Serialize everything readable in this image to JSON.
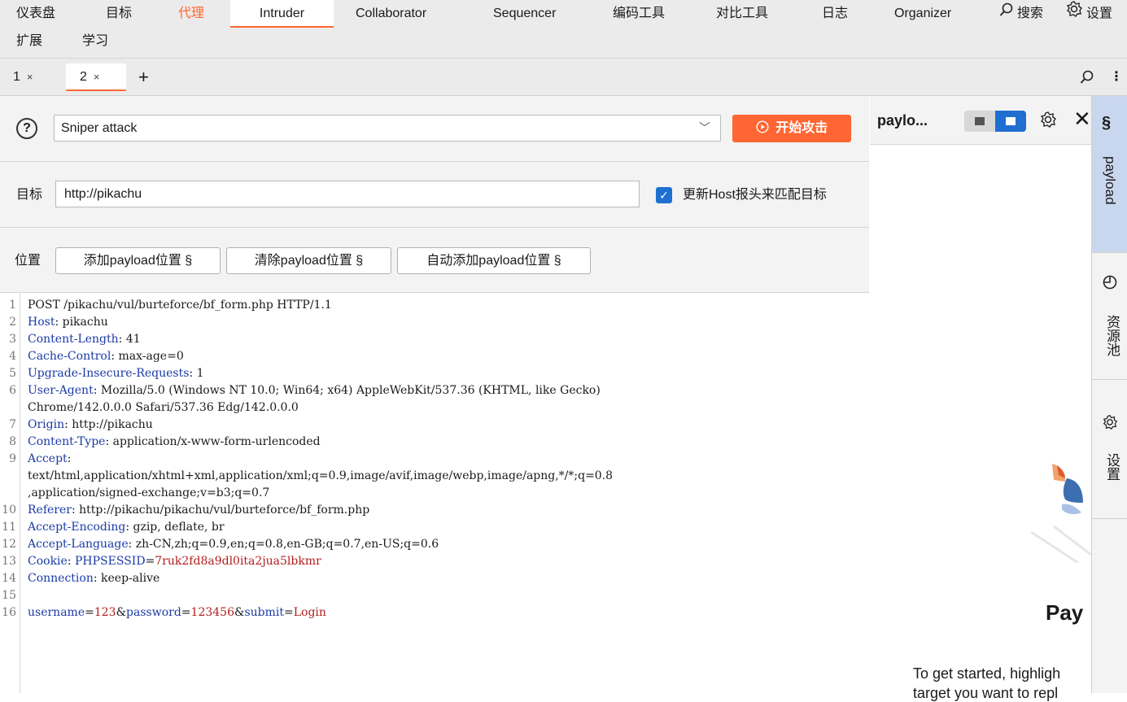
{
  "menu": {
    "row1": [
      "仪表盘",
      "目标",
      "代理",
      "Intruder",
      "Collaborator",
      "Sequencer",
      "编码工具",
      "对比工具",
      "日志",
      "Organizer"
    ],
    "search_label": "搜索",
    "settings_label": "设置",
    "row2": [
      "扩展",
      "学习"
    ],
    "active_item": "代理",
    "selected_item": "Intruder"
  },
  "tabs": {
    "items": [
      {
        "label": "1",
        "close": "×"
      },
      {
        "label": "2",
        "close": "×"
      }
    ],
    "add": "+",
    "more": "⋮"
  },
  "attack": {
    "help": "?",
    "type": "Sniper attack",
    "start_label": "开始攻击"
  },
  "target": {
    "label": "目标",
    "value": "http://pikachu",
    "update_host_label": "更新Host报头来匹配目标",
    "update_host_checked": true
  },
  "positions": {
    "label": "位置",
    "add_label": "添加payload位置 §",
    "clear_label": "清除payload位置 §",
    "auto_label": "自动添加payload位置 §"
  },
  "request_lines": [
    {
      "n": "1",
      "parts": [
        {
          "t": "POST /pikachu/vul/burteforce/bf_form.php HTTP/1.1",
          "c": ""
        }
      ]
    },
    {
      "n": "2",
      "parts": [
        {
          "t": "Host",
          "c": "key"
        },
        {
          "t": ": pikachu",
          "c": ""
        }
      ]
    },
    {
      "n": "3",
      "parts": [
        {
          "t": "Content-Length",
          "c": "key"
        },
        {
          "t": ": 41",
          "c": ""
        }
      ]
    },
    {
      "n": "4",
      "parts": [
        {
          "t": "Cache-Control",
          "c": "key"
        },
        {
          "t": ": max-age=0",
          "c": ""
        }
      ]
    },
    {
      "n": "5",
      "parts": [
        {
          "t": "Upgrade-Insecure-Requests",
          "c": "key"
        },
        {
          "t": ": 1",
          "c": ""
        }
      ]
    },
    {
      "n": "6",
      "parts": [
        {
          "t": "User-Agent",
          "c": "key"
        },
        {
          "t": ": Mozilla/5.0 (Windows NT 10.0; Win64; x64) AppleWebKit/537.36 (KHTML, like Gecko)",
          "c": ""
        }
      ]
    },
    {
      "n": "",
      "parts": [
        {
          "t": "Chrome/142.0.0.0 Safari/537.36 Edg/142.0.0.0",
          "c": ""
        }
      ]
    },
    {
      "n": "7",
      "parts": [
        {
          "t": "Origin",
          "c": "key"
        },
        {
          "t": ": http://pikachu",
          "c": ""
        }
      ]
    },
    {
      "n": "8",
      "parts": [
        {
          "t": "Content-Type",
          "c": "key"
        },
        {
          "t": ": application/x-www-form-urlencoded",
          "c": ""
        }
      ]
    },
    {
      "n": "9",
      "parts": [
        {
          "t": "Accept",
          "c": "key"
        },
        {
          "t": ":",
          "c": ""
        }
      ]
    },
    {
      "n": "",
      "parts": [
        {
          "t": "text/html,application/xhtml+xml,application/xml;q=0.9,image/avif,image/webp,image/apng,*/*;q=0.8",
          "c": ""
        }
      ]
    },
    {
      "n": "",
      "parts": [
        {
          "t": ",application/signed-exchange;v=b3;q=0.7",
          "c": ""
        }
      ]
    },
    {
      "n": "10",
      "parts": [
        {
          "t": "Referer",
          "c": "key"
        },
        {
          "t": ": http://pikachu/pikachu/vul/burteforce/bf_form.php",
          "c": ""
        }
      ]
    },
    {
      "n": "11",
      "parts": [
        {
          "t": "Accept-Encoding",
          "c": "key"
        },
        {
          "t": ": gzip, deflate, br",
          "c": ""
        }
      ]
    },
    {
      "n": "12",
      "parts": [
        {
          "t": "Accept-Language",
          "c": "key"
        },
        {
          "t": ": zh-CN,zh;q=0.9,en;q=0.8,en-GB;q=0.7,en-US;q=0.6",
          "c": ""
        }
      ]
    },
    {
      "n": "13",
      "parts": [
        {
          "t": "Cookie",
          "c": "key"
        },
        {
          "t": ": ",
          "c": ""
        },
        {
          "t": "PHPSESSID",
          "c": "key"
        },
        {
          "t": "=",
          "c": ""
        },
        {
          "t": "7ruk2fd8a9dl0ita2jua5lbkmr",
          "c": "val"
        }
      ]
    },
    {
      "n": "14",
      "parts": [
        {
          "t": "Connection",
          "c": "key"
        },
        {
          "t": ": keep-alive",
          "c": ""
        }
      ]
    },
    {
      "n": "15",
      "parts": []
    },
    {
      "n": "16",
      "parts": [
        {
          "t": "username",
          "c": "key"
        },
        {
          "t": "=",
          "c": ""
        },
        {
          "t": "123",
          "c": "val"
        },
        {
          "t": "&",
          "c": ""
        },
        {
          "t": "password",
          "c": "key"
        },
        {
          "t": "=",
          "c": ""
        },
        {
          "t": "123456",
          "c": "val"
        },
        {
          "t": "&",
          "c": ""
        },
        {
          "t": "submit",
          "c": "key"
        },
        {
          "t": "=",
          "c": ""
        },
        {
          "t": "Login",
          "c": "val"
        }
      ]
    }
  ],
  "side_panel": {
    "title": "paylo...",
    "heading": "Pay",
    "text1": "To get started, highligh",
    "text2": "target you want to repl"
  },
  "vertical_tabs": {
    "payload": "payload",
    "resource_pool": "资源池",
    "settings": "设置"
  },
  "colors": {
    "accent": "#ff6633",
    "checkbox": "#1f6fd1",
    "key": "#1a3aa6",
    "value": "#b21d1d"
  }
}
